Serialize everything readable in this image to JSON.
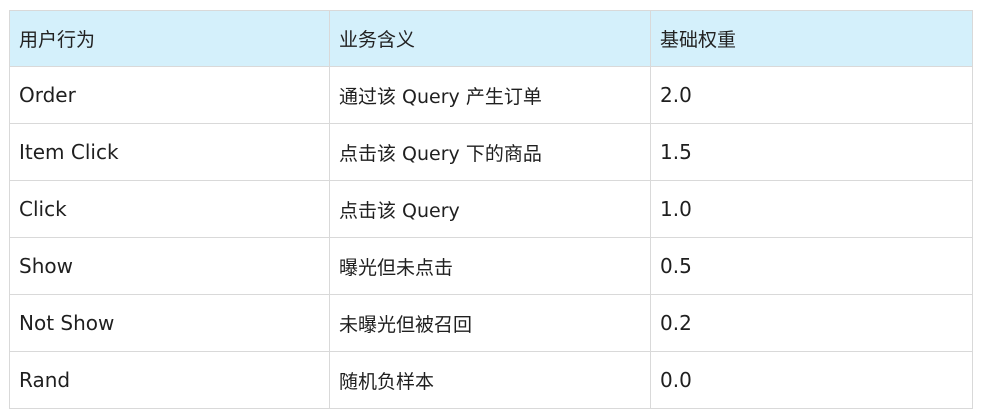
{
  "table": {
    "headers": [
      "用户行为",
      "业务含义",
      "基础权重"
    ],
    "rows": [
      {
        "behavior": "Order",
        "meaning": "通过该 Query 产生订单",
        "weight": "2.0"
      },
      {
        "behavior": "Item Click",
        "meaning": "点击该 Query 下的商品",
        "weight": "1.5"
      },
      {
        "behavior": "Click",
        "meaning": "点击该 Query",
        "weight": "1.0"
      },
      {
        "behavior": "Show",
        "meaning": "曝光但未点击",
        "weight": "0.5"
      },
      {
        "behavior": "Not Show",
        "meaning": "未曝光但被召回",
        "weight": "0.2"
      },
      {
        "behavior": "Rand",
        "meaning": "随机负样本",
        "weight": "0.0"
      }
    ],
    "header_background": "#d4f0fb",
    "border_color": "#d9d9d9"
  }
}
